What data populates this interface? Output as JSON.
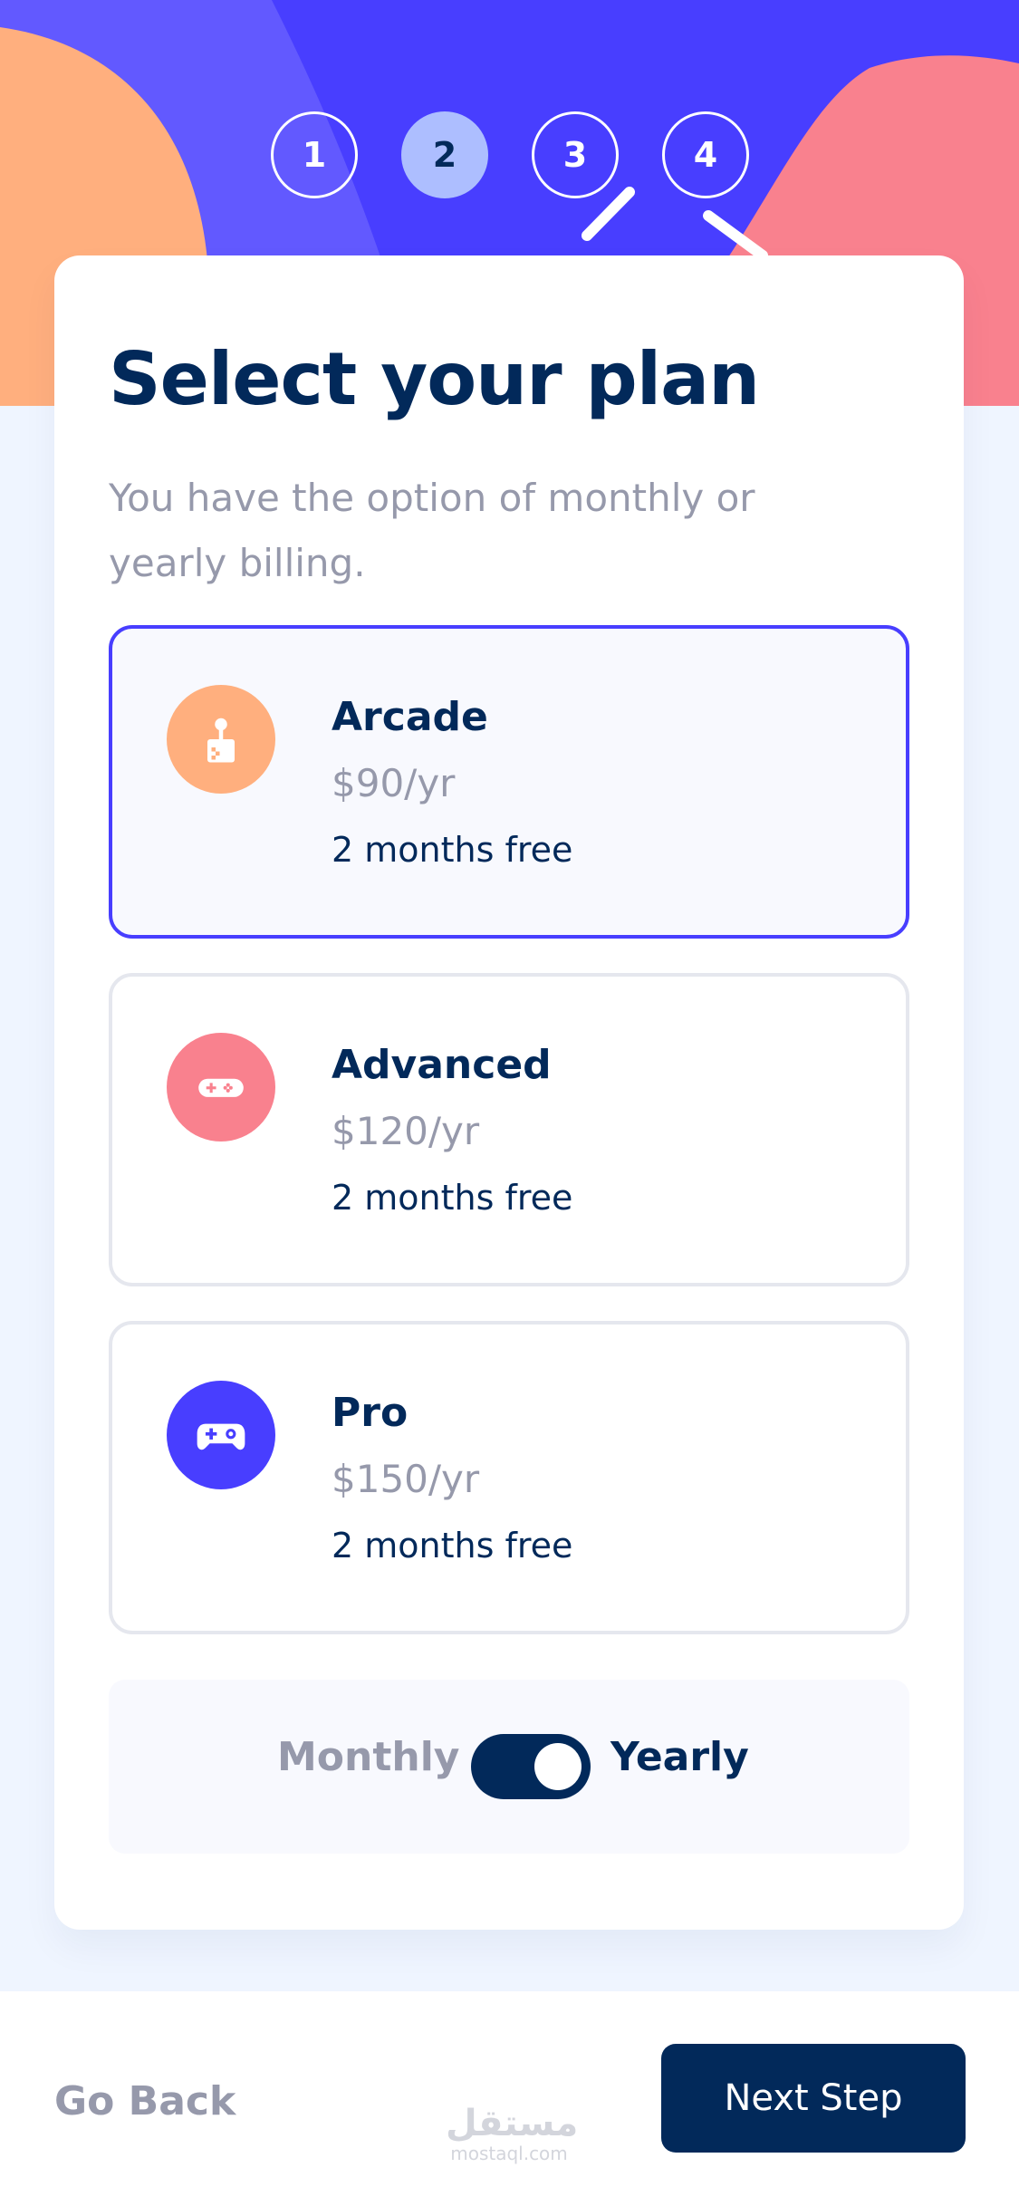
{
  "steps": [
    {
      "number": "1",
      "active": false
    },
    {
      "number": "2",
      "active": true
    },
    {
      "number": "3",
      "active": false
    },
    {
      "number": "4",
      "active": false
    }
  ],
  "header": {
    "title": "Select your plan",
    "subtitle": "You have the option of monthly or yearly billing."
  },
  "plans": [
    {
      "name": "Arcade",
      "price": "$90/yr",
      "promo": "2 months free",
      "icon": "arcade-icon",
      "color": "#ffaf7e",
      "selected": true
    },
    {
      "name": "Advanced",
      "price": "$120/yr",
      "promo": "2 months free",
      "icon": "gamepad-icon",
      "color": "#f9818e",
      "selected": false
    },
    {
      "name": "Pro",
      "price": "$150/yr",
      "promo": "2 months free",
      "icon": "controller-icon",
      "color": "#483eff",
      "selected": false
    }
  ],
  "billing": {
    "monthly_label": "Monthly",
    "yearly_label": "Yearly",
    "selected": "Yearly"
  },
  "footer": {
    "back_label": "Go Back",
    "next_label": "Next Step"
  },
  "watermark": {
    "arabic": "مستقل",
    "latin": "mostaql.com"
  },
  "colors": {
    "primary": "#02295a",
    "accent": "#483eff",
    "muted": "#9699ab",
    "background": "#eff5ff"
  }
}
